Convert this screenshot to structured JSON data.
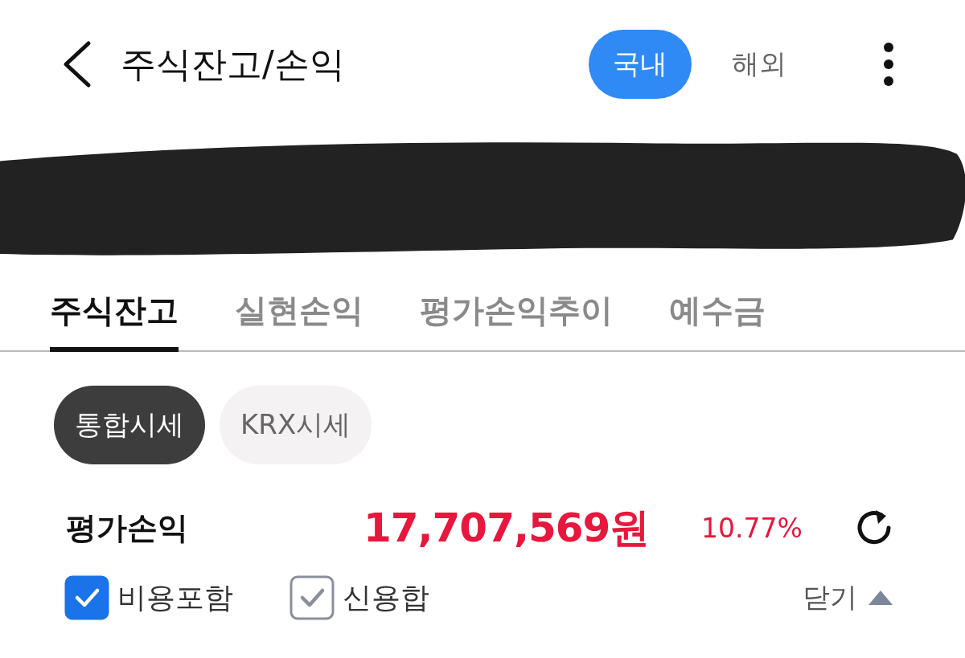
{
  "header": {
    "title": "주식잔고/손익",
    "market_tabs": [
      {
        "label": "국내",
        "selected": true
      },
      {
        "label": "해외",
        "selected": false
      }
    ]
  },
  "tabs": [
    {
      "label": "주식잔고",
      "selected": true
    },
    {
      "label": "실현손익",
      "selected": false
    },
    {
      "label": "평가손익추이",
      "selected": false
    },
    {
      "label": "예수금",
      "selected": false
    }
  ],
  "price_chips": [
    {
      "label": "통합시세",
      "selected": true
    },
    {
      "label": "KRX시세",
      "selected": false
    }
  ],
  "summary": {
    "label": "평가손익",
    "amount": "17,707,569원",
    "rate": "10.77%"
  },
  "options": [
    {
      "label": "비용포함",
      "checked": true
    },
    {
      "label": "신용합",
      "checked": false
    }
  ],
  "collapse": {
    "label": "닫기"
  }
}
